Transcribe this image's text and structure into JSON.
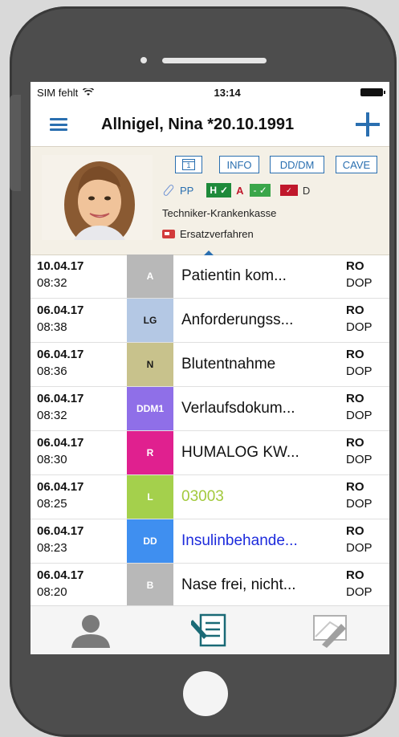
{
  "status": {
    "carrier": "SIM fehlt",
    "time": "13:14"
  },
  "nav": {
    "title": "Allnigel, Nina *20.10.1991"
  },
  "header": {
    "calendar_day": "1",
    "tags": [
      "INFO",
      "DD/DM",
      "CAVE"
    ],
    "pp": "PP",
    "h": "H",
    "a": "A",
    "d": "D",
    "insurance": "Techniker-Krankenkasse",
    "procedure": "Ersatzverfahren"
  },
  "entries": [
    {
      "date": "10.04.17",
      "time": "08:32",
      "type": "A",
      "type_color": "#b8b8b8",
      "text": "Patientin kom...",
      "text_color": "#111111",
      "who1": "RO",
      "who2": "DOP"
    },
    {
      "date": "06.04.17",
      "time": "08:38",
      "type": "LG",
      "type_color": "#b4c8e4",
      "type_text_color": "#1a1a1a",
      "text": "Anforderungss...",
      "text_color": "#111111",
      "who1": "RO",
      "who2": "DOP"
    },
    {
      "date": "06.04.17",
      "time": "08:36",
      "type": "N",
      "type_color": "#c8c28c",
      "type_text_color": "#1a1a1a",
      "text": "Blutentnahme",
      "text_color": "#111111",
      "who1": "RO",
      "who2": "DOP"
    },
    {
      "date": "06.04.17",
      "time": "08:32",
      "type": "DDM1",
      "type_color": "#8f6fe8",
      "text": "Verlaufsdokum...",
      "text_color": "#111111",
      "who1": "RO",
      "who2": "DOP"
    },
    {
      "date": "06.04.17",
      "time": "08:30",
      "type": "R",
      "type_color": "#e0208f",
      "text": "HUMALOG KW...",
      "text_color": "#111111",
      "who1": "RO",
      "who2": "DOP"
    },
    {
      "date": "06.04.17",
      "time": "08:25",
      "type": "L",
      "type_color": "#a4d04c",
      "text": "03003",
      "text_color": "#a2c93c",
      "who1": "RO",
      "who2": "DOP"
    },
    {
      "date": "06.04.17",
      "time": "08:23",
      "type": "DD",
      "type_color": "#3f8ff0",
      "text": "Insulinbehande...",
      "text_color": "#1d2bdc",
      "who1": "RO",
      "who2": "DOP"
    },
    {
      "date": "06.04.17",
      "time": "08:20",
      "type": "B",
      "type_color": "#b8b8b8",
      "text": "Nase frei, nicht...",
      "text_color": "#111111",
      "who1": "RO",
      "who2": "DOP"
    }
  ],
  "tabs": [
    "person-icon",
    "document-edit-icon",
    "draw-icon"
  ]
}
